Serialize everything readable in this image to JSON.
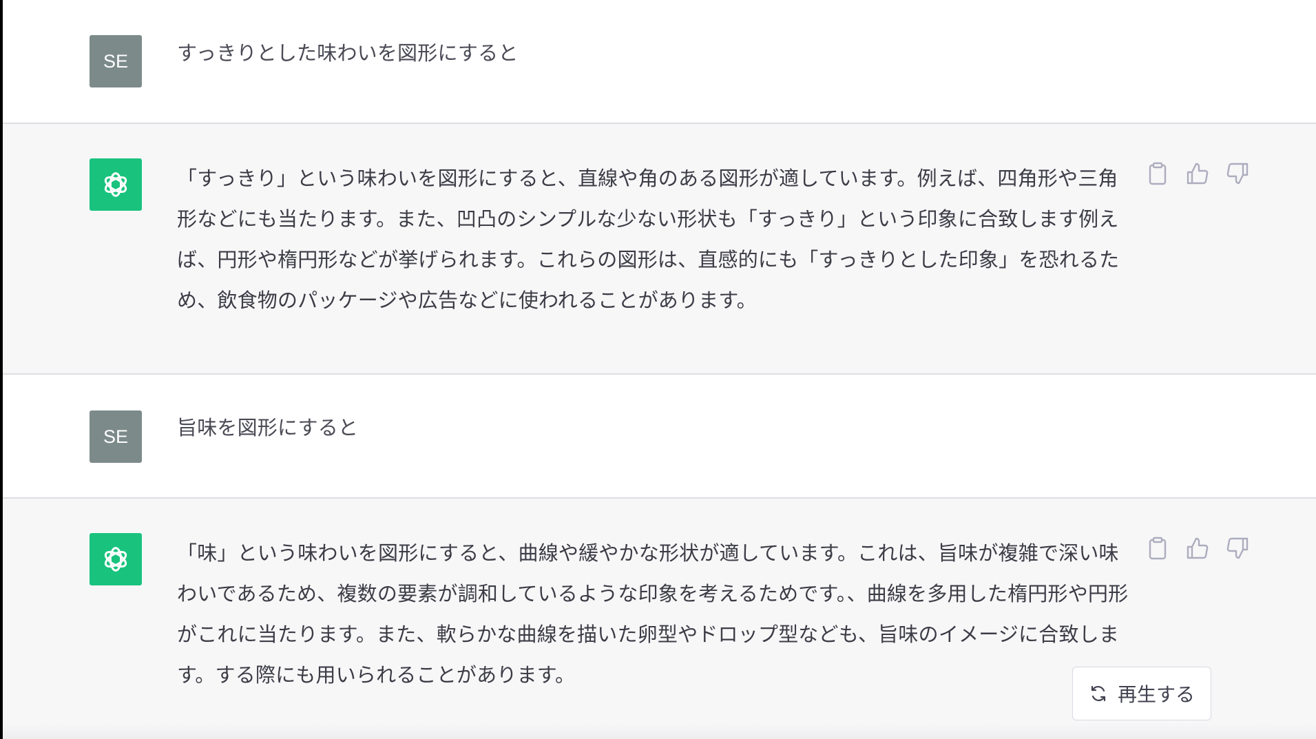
{
  "conversation": {
    "messages": [
      {
        "role": "user",
        "avatar_initials": "SE",
        "text": "すっきりとした味わいを図形にすると"
      },
      {
        "role": "assistant",
        "avatar_icon": "openai-logo-icon",
        "text": "「すっきり」という味わいを図形にすると、直線や角のある図形が適しています。例えば、四角形や三角形などにも当たります。また、凹凸のシンプルな少ない形状も「すっきり」という印象に合致します例えば、円形や楕円形などが挙げられます。これらの図形は、直感的にも「すっきりとした印象」を恐れるため、飲食物のパッケージや広告などに使われることがあります。"
      },
      {
        "role": "user",
        "avatar_initials": "SE",
        "text": "旨味を図形にすると"
      },
      {
        "role": "assistant",
        "avatar_icon": "openai-logo-icon",
        "text": "「味」という味わいを図形にすると、曲線や緩やかな形状が適しています。これは、旨味が複雑で深い味わいであるため、複数の要素が調和しているような印象を考えるためです。、曲線を多用した楕円形や円形がこれに当たります。また、軟らかな曲線を描いた卵型やドロップ型なども、旨味のイメージに合致します。する際にも用いられることがあります。"
      }
    ]
  },
  "actions": {
    "icons": [
      "clipboard-icon",
      "thumbs-up-icon",
      "thumbs-down-icon"
    ]
  },
  "regenerate": {
    "label": "再生する",
    "icon": "refresh-icon"
  },
  "colors": {
    "user_bg": "#ffffff",
    "assistant_bg": "#f7f7f8",
    "user_avatar": "#7c8a8a",
    "assistant_avatar": "#19c37d",
    "text": "#374151",
    "icon": "#acacbe"
  }
}
